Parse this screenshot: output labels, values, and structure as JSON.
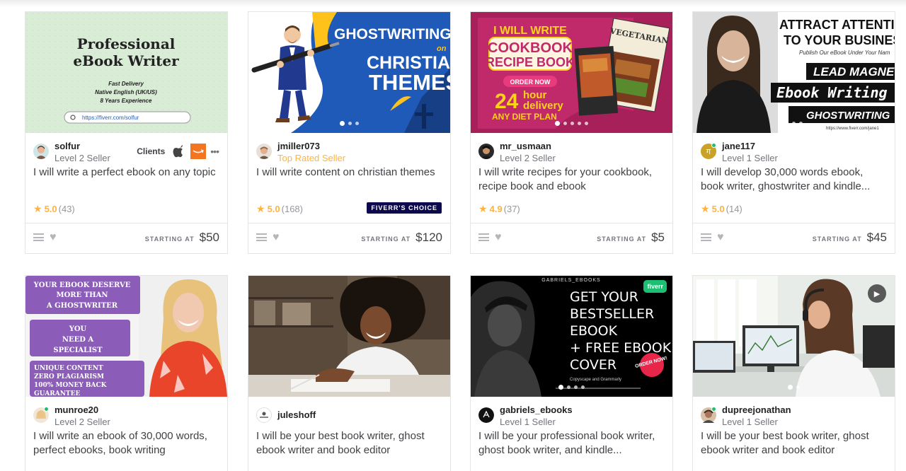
{
  "colors": {
    "accent": "#1dbf73",
    "star": "#ffb33e",
    "top_rated": "#ffb33e",
    "choice_bg": "#0d084d"
  },
  "gigs": [
    {
      "seller": "solfur",
      "level": "Level 2 Seller",
      "title": "I will write a perfect ebook on any topic",
      "rating": "5.0",
      "reviews": "(43)",
      "starting": "STARTING AT",
      "price": "$50",
      "clients_label": "Clients",
      "thumb": {
        "heading1": "Professional",
        "heading2": "eBook Writer",
        "line1": "Fast Delivery",
        "line2": "Native English (UK/US)",
        "line3": "8 Years Experience",
        "url": "https://fiverr.com/solfur"
      }
    },
    {
      "seller": "jmiller073",
      "level": "Top Rated Seller",
      "title": "I will write content on christian themes",
      "rating": "5.0",
      "reviews": "(168)",
      "choice": "FIVERR'S CHOICE",
      "starting": "STARTING AT",
      "price": "$120",
      "thumb": {
        "word1": "GHOSTWRITING",
        "word2": "on",
        "word3": "CHRISTIAN",
        "word4": "THEMES"
      }
    },
    {
      "seller": "mr_usmaan",
      "level": "Level 2 Seller",
      "title": "I will write recipes for your cookbook, recipe book and ebook",
      "rating": "4.9",
      "reviews": "(37)",
      "starting": "STARTING AT",
      "price": "$5",
      "thumb": {
        "line1": "I WILL WRITE",
        "line2": "COOKBOOK",
        "line3": "RECIPE BOOK",
        "order": "ORDER NOW",
        "num": "24",
        "hour": "hour",
        "delivery": "delivery",
        "diet": "ANY DIET PLAN",
        "book": "VEGETARIAN"
      }
    },
    {
      "seller": "jane117",
      "level": "Level 1 Seller",
      "title": "I will develop 30,000 words ebook, book writer, ghostwriter and kindle...",
      "rating": "5.0",
      "reviews": "(14)",
      "starting": "STARTING AT",
      "price": "$45",
      "thumb": {
        "line1": "ATTRACT ATTENTIO",
        "line2": "TO YOUR BUSINES",
        "sub": "Publish Our eBook Under Your Nam",
        "lead": "LEAD MAGNE",
        "ebook": "Ebook Writing",
        "ghost": "GHOSTWRITING",
        "url": "https://www.fiverr.com/jane1"
      }
    },
    {
      "seller": "munroe20",
      "level": "Level 2 Seller",
      "title": "I will write an ebook of 30,000 words, perfect ebooks, book writing",
      "thumb": {
        "b1a": "YOUR EBOOK DESERVE",
        "b1b": "MORE THAN",
        "b1c": "A GHOSTWRITER",
        "b2a": "YOU",
        "b2b": "NEED A",
        "b2c": "SPECIALIST",
        "b3a": "UNIQUE CONTENT",
        "b3b": "ZERO PLAGIARISM",
        "b3c": "100% MONEY BACK",
        "b3d": "GUARANTEE"
      }
    },
    {
      "seller": "juleshoff",
      "level": "",
      "title": "I will be your best book writer, ghost ebook writer and book editor"
    },
    {
      "seller": "gabriels_ebooks",
      "level": "Level 1 Seller",
      "title": "I will be your professional book writer, ghost book writer, and kindle...",
      "thumb": {
        "brand": "GABRIELS_EBOOKS",
        "l1": "GET YOUR",
        "l2": "BESTSELLER",
        "l3": "EBOOK",
        "l4": "+ FREE EBOOK",
        "l5": "COVER",
        "small": "Copyscape and Grammarly",
        "badge": "fiverr",
        "order": "ORDER NOW!"
      }
    },
    {
      "seller": "dupreejonathan",
      "level": "Level 1 Seller",
      "title": "I will be your best book writer, ghost ebook writer and book editor"
    }
  ]
}
